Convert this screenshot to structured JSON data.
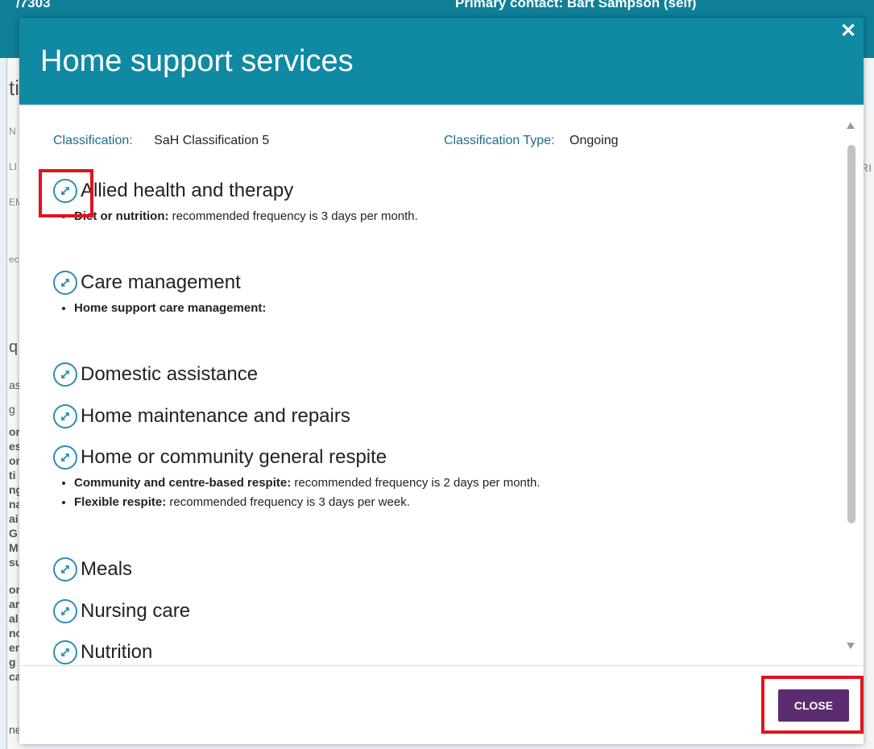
{
  "background": {
    "topbar_left": "/7303",
    "topbar_right": "Primary contact: Bart Sampson (self)",
    "left_fragments": [
      "ti",
      "N",
      "LI",
      "EM",
      "ec",
      "q",
      "as",
      "g",
      "or",
      "es",
      "on",
      "ti",
      "ng",
      "na",
      "ai",
      "G",
      "M",
      "su",
      "or",
      "ar",
      "al",
      "nc",
      "em",
      "g",
      "ca",
      "ne"
    ],
    "right_fragment": "RI"
  },
  "modal": {
    "title": "Home support services",
    "close_icon": "close-icon",
    "classification_label": "Classification:",
    "classification_value": "SaH Classification 5",
    "classification_type_label": "Classification Type:",
    "classification_type_value": "Ongoing",
    "sections": [
      {
        "title": "Allied health and therapy",
        "bullets": [
          {
            "label": "Diet or nutrition:",
            "text": " recommended frequency is 3 days per month."
          }
        ]
      },
      {
        "title": "Care management",
        "bullets": [
          {
            "label": "Home support care management:",
            "text": ""
          }
        ]
      },
      {
        "title": "Domestic assistance",
        "bullets": []
      },
      {
        "title": "Home maintenance and repairs",
        "bullets": []
      },
      {
        "title": "Home or community general respite",
        "bullets": [
          {
            "label": "Community and centre-based respite:",
            "text": " recommended frequency is 2 days per month."
          },
          {
            "label": "Flexible respite:",
            "text": " recommended frequency is 3 days per week."
          }
        ]
      },
      {
        "title": "Meals",
        "bullets": []
      },
      {
        "title": "Nursing care",
        "bullets": []
      },
      {
        "title": "Nutrition",
        "bullets": []
      }
    ],
    "close_button_label": "CLOSE",
    "expand_icon": "expand-arrows-icon"
  },
  "colors": {
    "header": "#108aa2",
    "close_button": "#5b2c6f",
    "highlight": "#e0141f",
    "label": "#1f6c87"
  }
}
